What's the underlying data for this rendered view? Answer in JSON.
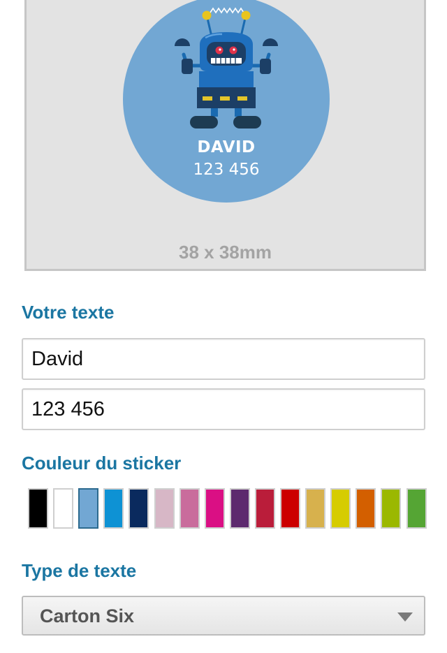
{
  "preview": {
    "sticker_line1": "DAVID",
    "sticker_line2": "123 456",
    "size_label": "38 x 38mm",
    "sticker_color": "#72a7d3",
    "illustration": "robot"
  },
  "text_section": {
    "title": "Votre texte",
    "line1_value": "David",
    "line2_value": "123 456"
  },
  "color_section": {
    "title": "Couleur du sticker",
    "swatches": [
      {
        "color": "#000000",
        "selected": false
      },
      {
        "color": "#ffffff",
        "selected": false
      },
      {
        "color": "#72a7d3",
        "selected": true
      },
      {
        "color": "#0e92d4",
        "selected": false
      },
      {
        "color": "#0a2a5e",
        "selected": false
      },
      {
        "color": "#d7b7c6",
        "selected": false
      },
      {
        "color": "#c96c9c",
        "selected": false
      },
      {
        "color": "#da0f84",
        "selected": false
      },
      {
        "color": "#5d2a6e",
        "selected": false
      },
      {
        "color": "#ba1d3a",
        "selected": false
      },
      {
        "color": "#cc0000",
        "selected": false
      },
      {
        "color": "#d7b14d",
        "selected": false
      },
      {
        "color": "#d6cc00",
        "selected": false
      },
      {
        "color": "#d35f00",
        "selected": false
      },
      {
        "color": "#9bb800",
        "selected": false
      },
      {
        "color": "#55a534",
        "selected": false
      }
    ]
  },
  "font_section": {
    "title": "Type de texte",
    "selected_font": "Carton Six",
    "arrow_icon": "chevron-down-icon"
  },
  "colors": {
    "accent": "#1b76a2",
    "panel_background": "#e3e3e3"
  }
}
